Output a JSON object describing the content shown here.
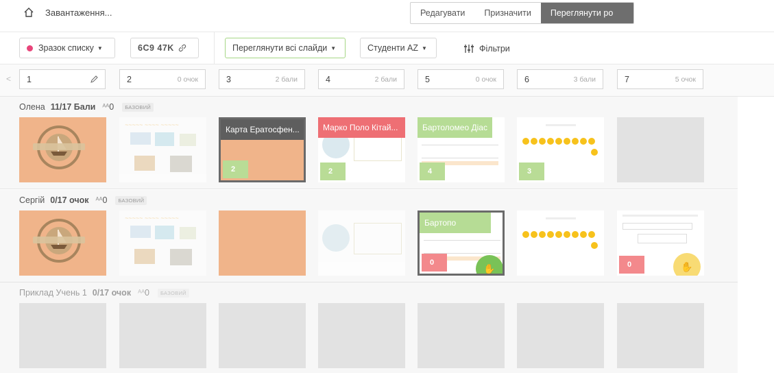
{
  "top": {
    "loading": "Завантаження...",
    "tabs": [
      {
        "label": "Редагувати",
        "active": false
      },
      {
        "label": "Призначити",
        "active": false
      },
      {
        "label": "Переглянути ро",
        "active": true
      }
    ]
  },
  "toolbar": {
    "class_label": "Зразок списку",
    "class_color": "#e8457a",
    "code": "6C9 47K",
    "view_all": "Переглянути всі слайди",
    "sort": "Студенти AZ",
    "filters": "Фільтри"
  },
  "slides": [
    {
      "num": "1",
      "pts": ""
    },
    {
      "num": "2",
      "pts": "0 очок"
    },
    {
      "num": "3",
      "pts": "2 бали"
    },
    {
      "num": "4",
      "pts": "2 бали"
    },
    {
      "num": "5",
      "pts": "0 очок"
    },
    {
      "num": "6",
      "pts": "3 бали"
    },
    {
      "num": "7",
      "pts": "5 очок"
    }
  ],
  "students": [
    {
      "name": "Олена",
      "score": "11/17 Бали",
      "group": "0",
      "badge": "БАЗОВИЙ",
      "cards": [
        {
          "type": "ship"
        },
        {
          "type": "doc"
        },
        {
          "type": "titled",
          "title": "Карта Ератосфен...",
          "style": "dark",
          "score": "2",
          "score_color": "green",
          "selected": true
        },
        {
          "type": "titled",
          "title": "Марко Поло Кітай...",
          "style": "red",
          "score": "2",
          "score_color": "green"
        },
        {
          "type": "titled",
          "title": "Бартоломео Діас",
          "style": "green",
          "score": "4",
          "score_color": "green"
        },
        {
          "type": "dots",
          "score": "3",
          "score_color": "green"
        },
        {
          "type": "grey"
        }
      ]
    },
    {
      "name": "Сергій",
      "score": "0/17 очок",
      "group": "0",
      "badge": "БАЗОВИЙ",
      "cards": [
        {
          "type": "ship"
        },
        {
          "type": "doc"
        },
        {
          "type": "orange"
        },
        {
          "type": "globe"
        },
        {
          "type": "titled",
          "title": "Бартопо",
          "style": "green",
          "score": "0",
          "score_color": "red",
          "selected": true,
          "hand": "green"
        },
        {
          "type": "dots"
        },
        {
          "type": "form",
          "score": "0",
          "score_color": "red",
          "hand": "yellow"
        }
      ]
    },
    {
      "name": "Приклад Учень 1",
      "score": "0/17 очок",
      "group": "0",
      "badge": "БАЗОВИЙ",
      "cards": [
        {
          "type": "grey"
        },
        {
          "type": "grey"
        },
        {
          "type": "grey"
        },
        {
          "type": "grey"
        },
        {
          "type": "grey"
        },
        {
          "type": "grey"
        },
        {
          "type": "grey"
        }
      ]
    }
  ]
}
